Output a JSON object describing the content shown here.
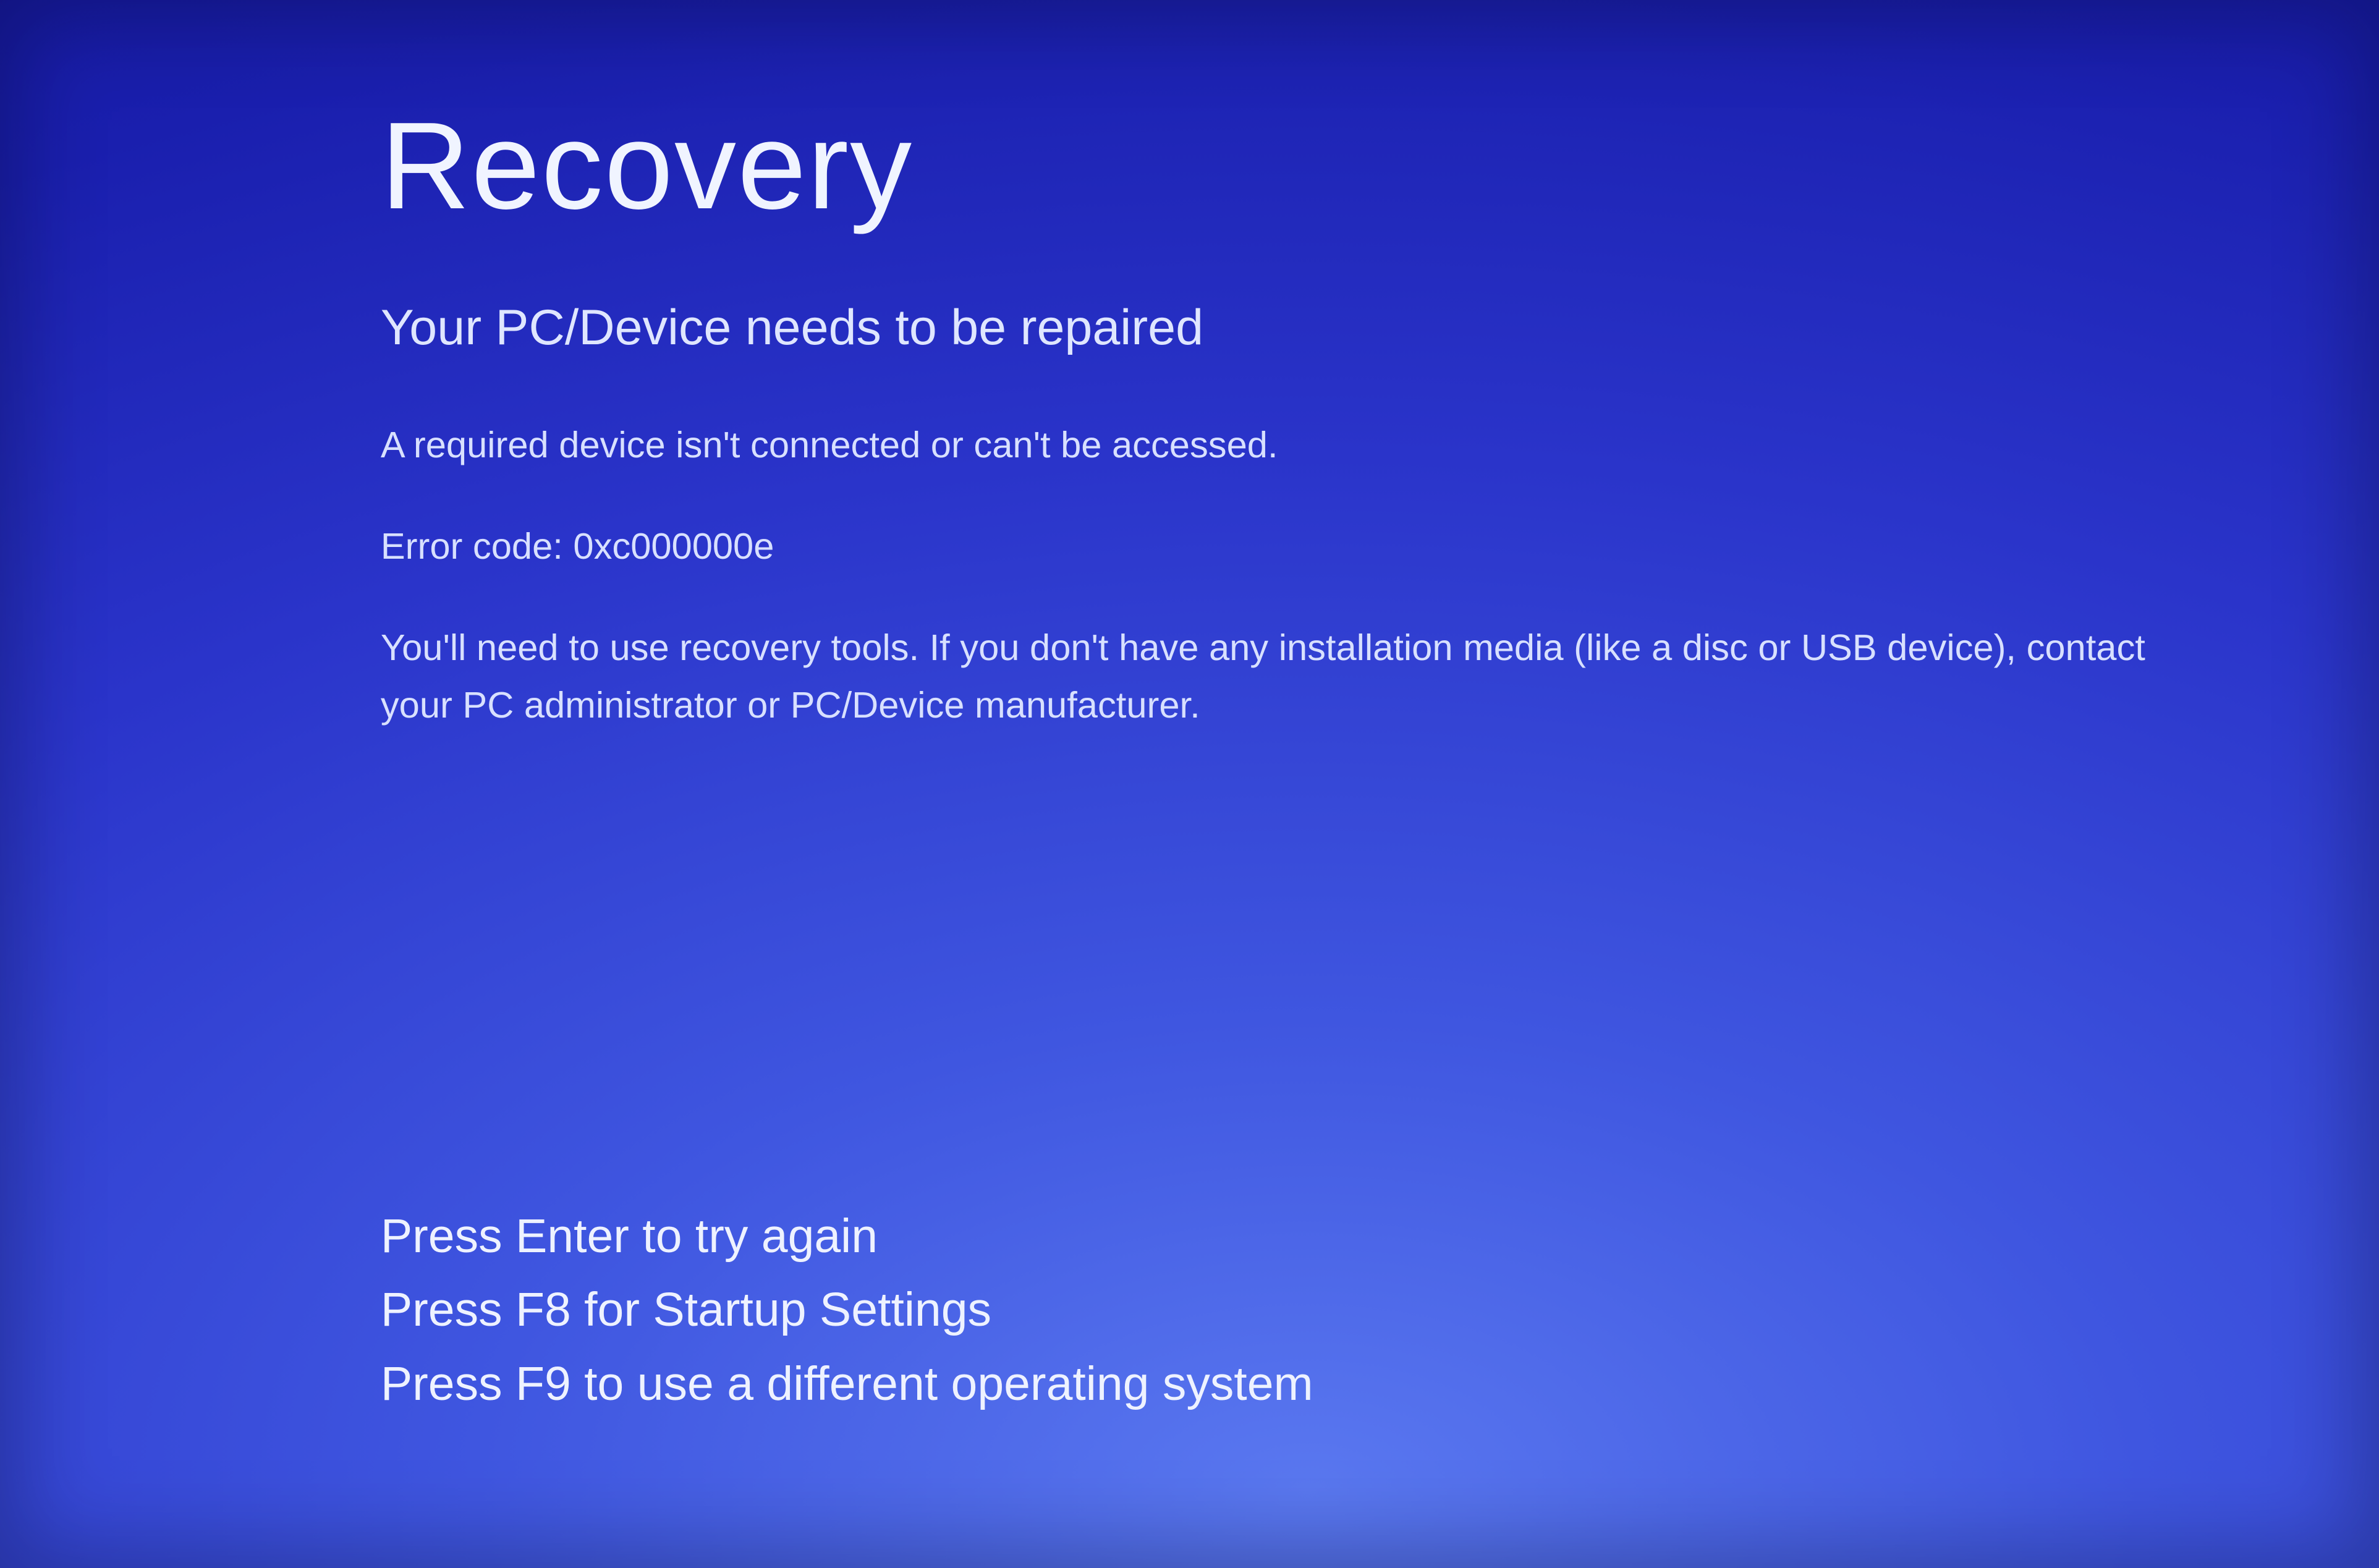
{
  "recovery": {
    "title": "Recovery",
    "subtitle": "Your PC/Device needs to be repaired",
    "cause": "A required device isn't connected or can't be accessed.",
    "error_line": "Error code: 0xc000000e",
    "instructions": "You'll need to use recovery tools. If you don't have any installation media (like a disc or USB device), contact your PC administrator or PC/Device manufacturer.",
    "actions": {
      "enter": "Press Enter to try again",
      "f8": "Press F8 for Startup Settings",
      "f9": "Press F9 to use a different operating system"
    }
  }
}
